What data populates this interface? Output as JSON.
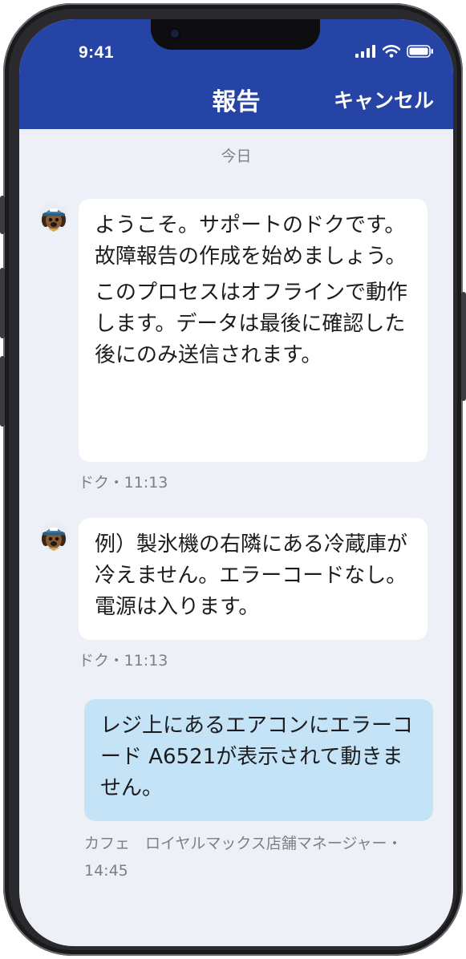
{
  "status_bar": {
    "time": "9:41"
  },
  "header": {
    "title": "報告",
    "cancel_label": "キャンセル"
  },
  "chat": {
    "date_label": "今日",
    "messages": [
      {
        "sender": "bot",
        "paragraphs": [
          "ようこそ。サポートのドクです。故障報告の作成を始めましょう。",
          "このプロセスはオフラインで動作します。データは最後に確認した後にのみ送信されます。"
        ],
        "meta": "ドク・11:13"
      },
      {
        "sender": "bot",
        "paragraphs": [
          "例）製氷機の右隣にある冷蔵庫が冷えません。エラーコードなし。電源は入ります。"
        ],
        "meta": "ドク・11:13"
      },
      {
        "sender": "user",
        "paragraphs": [
          "レジ上にあるエアコンにエラーコード A6521が表示されて動きません。"
        ],
        "meta": "カフェ　ロイヤルマックス店舗マネージャー・14:45"
      }
    ]
  },
  "colors": {
    "header": "#2544a6",
    "background": "#edf1f7",
    "bot_bubble": "#ffffff",
    "user_bubble": "#c5e3f7"
  },
  "icons": {
    "avatar": "dog-avatar-icon",
    "signal": "signal-icon",
    "wifi": "wifi-icon",
    "battery": "battery-icon"
  }
}
